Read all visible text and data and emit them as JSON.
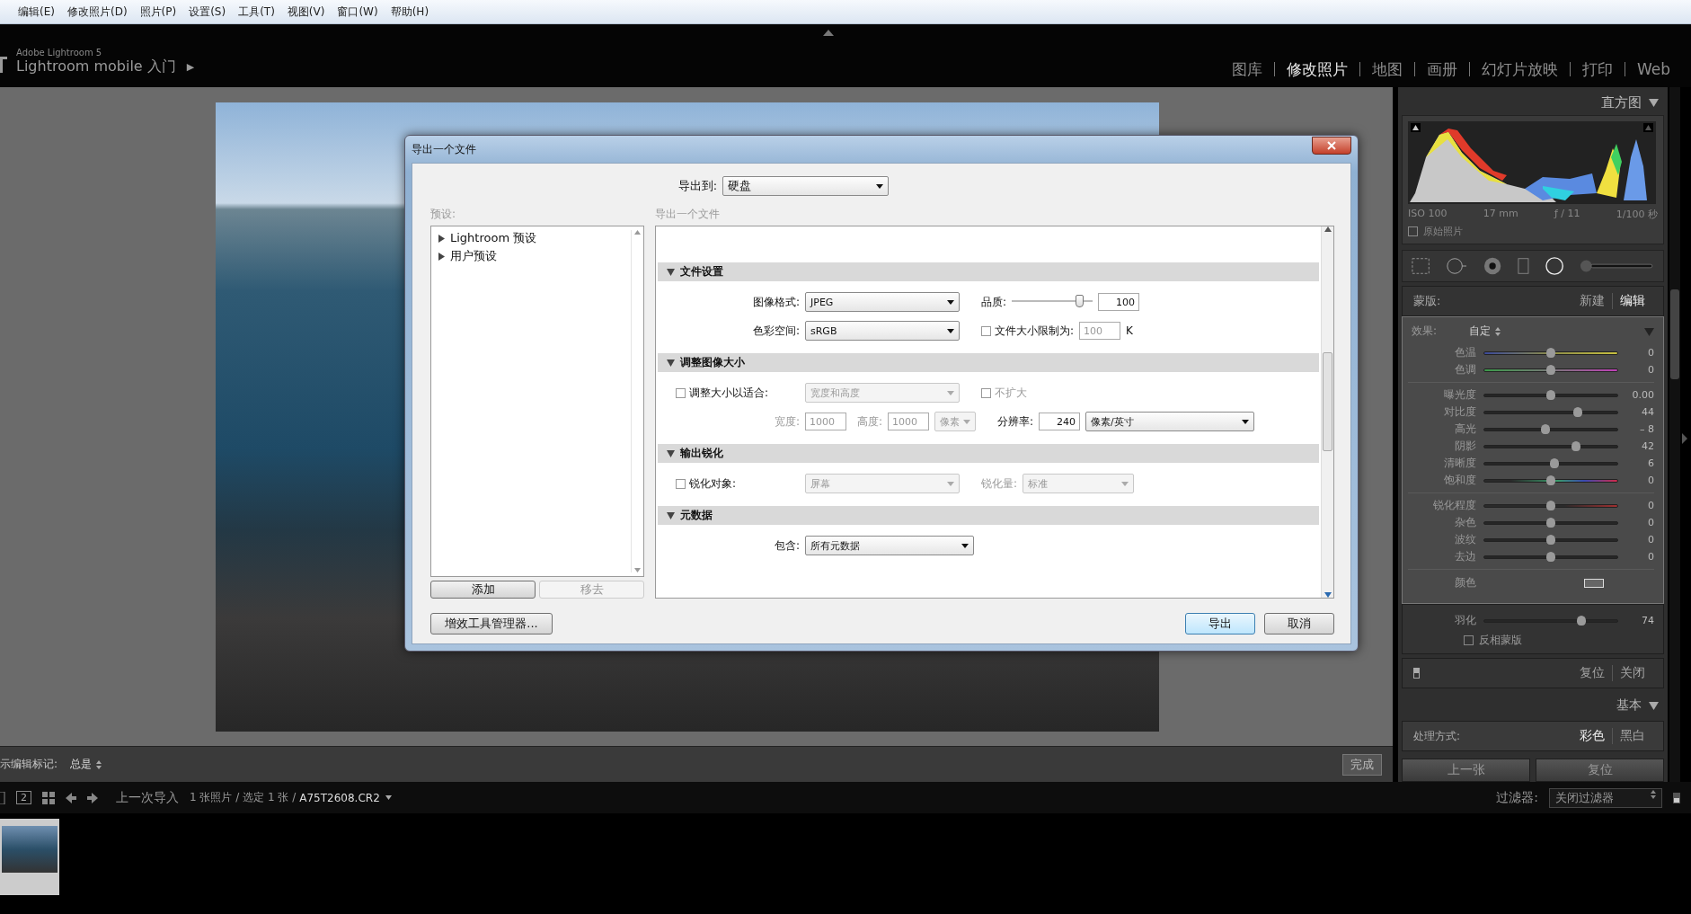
{
  "menu_bar": {
    "items": [
      "编辑(E)",
      "修改照片(D)",
      "照片(P)",
      "设置(S)",
      "工具(T)",
      "视图(V)",
      "窗口(W)",
      "帮助(H)"
    ]
  },
  "header": {
    "brand_small": "Adobe Lightroom 5",
    "brand": "Lightroom mobile 入门",
    "brand_arrow": "▶",
    "modules": [
      {
        "label": "图库",
        "selected": false
      },
      {
        "label": "修改照片",
        "selected": true
      },
      {
        "label": "地图",
        "selected": false
      },
      {
        "label": "画册",
        "selected": false
      },
      {
        "label": "幻灯片放映",
        "selected": false
      },
      {
        "label": "打印",
        "selected": false
      },
      {
        "label": "Web",
        "selected": false
      }
    ]
  },
  "right_panel": {
    "histogram": {
      "title": "直方图",
      "exif": [
        "ISO 100",
        "17 mm",
        "ƒ / 11",
        "1/100 秒"
      ],
      "original_label": "原始照片",
      "original_checked": false
    },
    "mask": {
      "label": "蒙版:",
      "options": [
        {
          "label": "新建",
          "selected": false
        },
        {
          "label": "编辑",
          "selected": true
        }
      ]
    },
    "effect": {
      "label": "效果:",
      "value": "自定"
    },
    "slider_groups": [
      {
        "sliders": [
          {
            "label": "色温",
            "value": "0",
            "level": 0.5,
            "kind": "temperature"
          },
          {
            "label": "色调",
            "value": "0",
            "level": 0.5,
            "kind": "tint"
          }
        ]
      },
      {
        "sliders": [
          {
            "label": "曝光度",
            "value": "0.00",
            "level": 0.5,
            "kind": "plain"
          },
          {
            "label": "对比度",
            "value": "44",
            "level": 0.7,
            "kind": "plain"
          },
          {
            "label": "高光",
            "value": "– 8",
            "level": 0.46,
            "kind": "plain"
          },
          {
            "label": "阴影",
            "value": "42",
            "level": 0.69,
            "kind": "plain"
          },
          {
            "label": "清晰度",
            "value": "6",
            "level": 0.53,
            "kind": "plain"
          },
          {
            "label": "饱和度",
            "value": "0",
            "level": 0.5,
            "kind": "saturation"
          }
        ]
      },
      {
        "sliders": [
          {
            "label": "锐化程度",
            "value": "0",
            "level": 0.5,
            "kind": "sharpness"
          },
          {
            "label": "杂色",
            "value": "0",
            "level": 0.5,
            "kind": "plain"
          },
          {
            "label": "波纹",
            "value": "0",
            "level": 0.5,
            "kind": "plain"
          },
          {
            "label": "去边",
            "value": "0",
            "level": 0.5,
            "kind": "plain"
          }
        ]
      }
    ],
    "color_label": "颜色",
    "feather": {
      "label": "羽化",
      "value": "74",
      "level": 0.73
    },
    "invert": {
      "label": "反相蒙版",
      "checked": false
    },
    "footer_actions": [
      "复位",
      "关闭"
    ],
    "basic_title": "基本",
    "treatment": {
      "label": "处理方式:",
      "options": [
        {
          "label": "彩色",
          "selected": true
        },
        {
          "label": "黑白",
          "selected": false
        }
      ]
    },
    "buttons": [
      "上一张",
      "复位"
    ]
  },
  "toolbar": {
    "label": "示编辑标记:",
    "value": "总是",
    "done": "完成"
  },
  "filmstrip_bar": {
    "page": "2",
    "source": "上一次导入",
    "info": "1 张照片 / 选定 1 张 /",
    "file": "A75T2608.CR2",
    "filter_label": "过滤器:",
    "filter": "关闭过滤器"
  },
  "dialog": {
    "title": "导出一个文件",
    "export_to_label": "导出到:",
    "export_to": "硬盘",
    "presets_label": "预设:",
    "presets": [
      "Lightroom 预设",
      "用户预设"
    ],
    "add": "添加",
    "remove": {
      "label": "移去",
      "disabled": true
    },
    "content_label": "导出一个文件",
    "sections": [
      {
        "title": "文件设置",
        "expanded": true,
        "rows": [
          {
            "fields": [
              {
                "kind": "label",
                "text": "图像格式:"
              },
              {
                "kind": "select",
                "text": "JPEG"
              },
              {
                "kind": "label",
                "text": "品质:"
              },
              {
                "kind": "slider",
                "level": 0.83
              },
              {
                "kind": "input",
                "text": "100"
              }
            ]
          },
          {
            "fields": [
              {
                "kind": "label",
                "text": "色彩空间:"
              },
              {
                "kind": "select",
                "text": "sRGB"
              },
              {
                "kind": "checkbox",
                "text": "文件大小限制为:",
                "checked": false
              },
              {
                "kind": "input",
                "text": "100",
                "disabled": true
              },
              {
                "kind": "label",
                "text": "K"
              }
            ]
          }
        ]
      },
      {
        "title": "调整图像大小",
        "expanded": true,
        "rows": [
          {
            "fields": [
              {
                "kind": "checkbox",
                "text": "调整大小以适合:",
                "checked": false
              },
              {
                "kind": "select",
                "text": "宽度和高度",
                "disabled": true
              },
              {
                "kind": "checkbox",
                "text": "不扩大",
                "checked": false,
                "disabled": true
              }
            ]
          },
          {
            "fields": [
              {
                "kind": "label",
                "text": "宽度:",
                "disabled": true
              },
              {
                "kind": "input",
                "text": "1000",
                "disabled": true
              },
              {
                "kind": "label",
                "text": "高度:",
                "disabled": true
              },
              {
                "kind": "input",
                "text": "1000",
                "disabled": true
              },
              {
                "kind": "narrowselect",
                "text": "像素",
                "disabled": true
              },
              {
                "kind": "label",
                "text": "分辨率:"
              },
              {
                "kind": "input",
                "text": "240"
              },
              {
                "kind": "wideselect",
                "text": "像素/英寸"
              }
            ]
          }
        ]
      },
      {
        "title": "输出锐化",
        "expanded": true,
        "rows": [
          {
            "fields": [
              {
                "kind": "checkbox",
                "text": "锐化对象:",
                "checked": false
              },
              {
                "kind": "select",
                "text": "屏幕",
                "disabled": true
              },
              {
                "kind": "label",
                "text": "锐化量:",
                "disabled": true
              },
              {
                "kind": "midselect",
                "text": "标准",
                "disabled": true
              }
            ]
          }
        ]
      },
      {
        "title": "元数据",
        "expanded": true,
        "rows": [
          {
            "fields": [
              {
                "kind": "label",
                "text": "包含:"
              },
              {
                "kind": "wideselect",
                "text": "所有元数据"
              }
            ]
          }
        ]
      }
    ],
    "plugin_manager": "增效工具管理器...",
    "export": "导出",
    "cancel": "取消"
  }
}
